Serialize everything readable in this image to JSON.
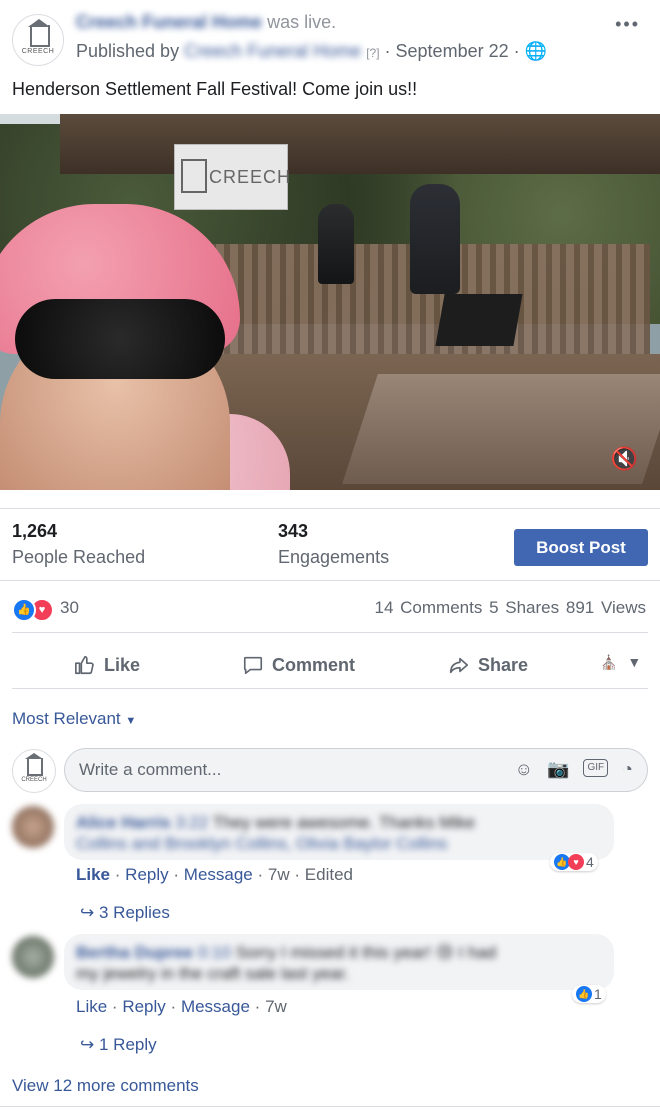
{
  "header": {
    "page_name": "Creech Funeral Home",
    "was_live_text": "was live.",
    "published_by_label": "Published by",
    "publisher_name": "Creech Funeral Home",
    "qmark": "[?]",
    "date": "September 22",
    "avatar_label": "CREECH",
    "more_label": "•••"
  },
  "post": {
    "caption": "Henderson Settlement Fall Festival! Come join us!!",
    "video_banner_text": "CREECH"
  },
  "stats": {
    "reached_value": "1,264",
    "reached_label": "People Reached",
    "engagements_value": "343",
    "engagements_label": "Engagements",
    "boost_label": "Boost Post"
  },
  "reactions": {
    "count": "30",
    "comments": "14 Comments",
    "shares": "5 Shares",
    "views": "891 Views"
  },
  "actions": {
    "like": "Like",
    "comment": "Comment",
    "share": "Share"
  },
  "comments_section": {
    "sort_label": "Most Relevant",
    "composer_placeholder": "Write a comment...",
    "gif_label": "GIF",
    "view_more": "View 12 more comments",
    "comments": [
      {
        "author": "Alice Harris",
        "time_prefix": "3:22",
        "text_line1": "They were awesome. Thanks Mike",
        "text_line2": "Collins and Brooklyn Collins, Olivia Baylor Collins",
        "reaction_count": "4",
        "like": "Like",
        "reply": "Reply",
        "message": "Message",
        "age": "7w",
        "edited": "Edited",
        "replies": "3 Replies"
      },
      {
        "author": "Bertha Dupree",
        "time_prefix": "0:10",
        "text_line1": "Sorry I missed it this year! 😢 I had",
        "text_line2": "my jewelry in the craft sale last year.",
        "reaction_count": "1",
        "like": "Like",
        "reply": "Reply",
        "message": "Message",
        "age": "7w",
        "replies": "1 Reply"
      }
    ]
  },
  "colors": {
    "link": "#385898",
    "boost": "#4267b2",
    "like_blue": "#1877f2",
    "love_red": "#f33e58"
  }
}
